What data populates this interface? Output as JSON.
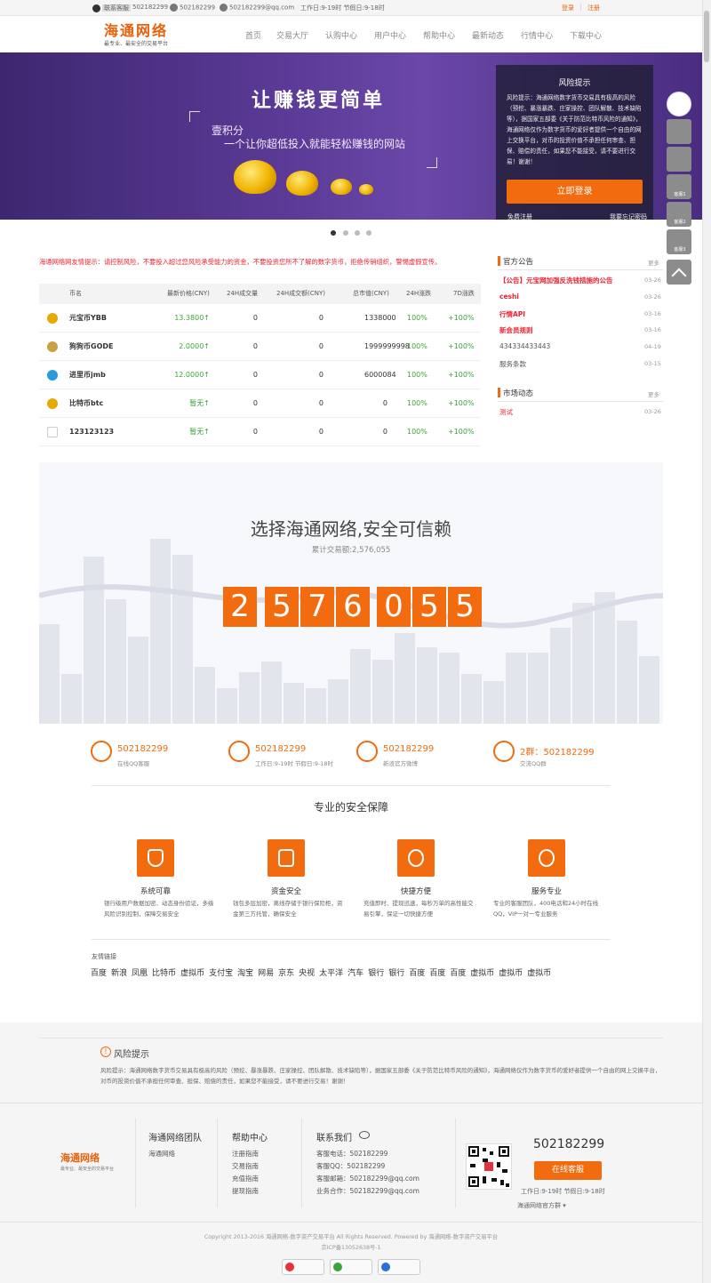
{
  "topbar": {
    "service": "联系客服",
    "qq": "502182299",
    "phone": "502182299",
    "email": "502182299@qq.com",
    "hours": "工作日:9-19时 节假日:9-18时",
    "login": "登录",
    "sep": "|",
    "register": "注册"
  },
  "logo": {
    "name": "海通网络",
    "slogan": "最专业、最安全的交易平台"
  },
  "nav": [
    "首页",
    "交易大厅",
    "认购中心",
    "用户中心",
    "帮助中心",
    "最新动态",
    "行情中心",
    "下载中心"
  ],
  "banner": {
    "slogan": "让赚钱更简单",
    "sub1": "壹积分",
    "sub2": "一个让你超低投入就能轻松赚钱的网站"
  },
  "risk": {
    "title": "风险提示",
    "body": "风险提示：海通网络数字货币交易具有极高的风险（预挖、暴涨暴跌、庄家操控、团队解散、技术缺陷等），据国家五部委《关于防范比特币风险的通知》，海通网络仅作为数字货币的爱好者提供一个自由的网上交换平台，对币的投资价值不承担任何审查、担保、赔偿的责任，如果您不能接受，请不要进行交易！谢谢！",
    "login": "立即登录",
    "free_reg": "免费注册",
    "forgot": "我要忘记密码"
  },
  "notice": "海通网络网友情提示：请控制风险，不要投入超过您风险承受能力的资金，不要投资您所不了解的数字货币，拒绝传销组织，警惕虚假宣传。",
  "table": {
    "headers": [
      "币名",
      "最新价格(CNY)",
      "24H成交量",
      "24H成交额(CNY)",
      "总市值(CNY)",
      "24H涨跌",
      "7D涨跌"
    ],
    "rows": [
      {
        "name": "元宝币YBB",
        "price": "13.3800↑",
        "vol": "0",
        "amt": "0",
        "cap": "1338000",
        "d24": "100%",
        "d7": "+100%",
        "color": "#e5a900"
      },
      {
        "name": "狗狗币GODE",
        "price": "2.0000↑",
        "vol": "0",
        "amt": "0",
        "cap": "1999999998",
        "d24": "100%",
        "d7": "+100%",
        "color": "#c8a242"
      },
      {
        "name": "进里币jmb",
        "price": "12.0000↑",
        "vol": "0",
        "amt": "0",
        "cap": "6000084",
        "d24": "100%",
        "d7": "+100%",
        "color": "#2a9ad9"
      },
      {
        "name": "比特币btc",
        "price": "暂无↑",
        "vol": "0",
        "amt": "0",
        "cap": "0",
        "d24": "100%",
        "d7": "+100%",
        "color": "#e5a900"
      },
      {
        "name": "123123123",
        "price": "暂无↑",
        "vol": "0",
        "amt": "0",
        "cap": "0",
        "d24": "100%",
        "d7": "+100%",
        "color": "#cccccc"
      }
    ]
  },
  "announce": {
    "title": "官方公告",
    "more": "更多",
    "items": [
      {
        "t": "【公告】元宝网加强反洗钱措施的公告",
        "d": "03-26",
        "red": true
      },
      {
        "t": "ceshi",
        "d": "03-26",
        "red": true
      },
      {
        "t": "行情API",
        "d": "03-16",
        "red": true
      },
      {
        "t": "新会员规则",
        "d": "03-16",
        "red": true
      },
      {
        "t": "434334433443",
        "d": "04-19",
        "red": false
      },
      {
        "t": "服务条款",
        "d": "03-15",
        "red": false
      }
    ]
  },
  "market": {
    "title": "市场动态",
    "more": "更多",
    "items": [
      {
        "t": "测试",
        "d": "03-26"
      }
    ]
  },
  "stats": {
    "title": "选择海通网络,安全可信赖",
    "sub": "累计交易额:2,576,055",
    "digits": [
      "2",
      "5",
      "7",
      "6",
      "0",
      "5",
      "5"
    ]
  },
  "contacts": [
    {
      "num": "502182299",
      "sub": "在线QQ客服",
      "icon": "qq-icon"
    },
    {
      "num": "502182299",
      "sub": "工作日:9-19时 节假日:9-18时",
      "icon": "phone-icon"
    },
    {
      "num": "502182299",
      "sub": "新浪官方微博",
      "icon": "weibo-icon"
    },
    {
      "num": "2群：502182299",
      "sub": "交流QQ群",
      "icon": "group-icon"
    }
  ],
  "security": {
    "title": "专业的安全保障",
    "items": [
      {
        "t": "系统可靠",
        "d": "银行级用户数据加密、动态身份验证，多级风险识别控制，保障交易安全",
        "icon": "shield-icon"
      },
      {
        "t": "资金安全",
        "d": "钱包多层加密，离线存储于银行保险柜，资金第三方托管，确保安全",
        "icon": "lock-icon"
      },
      {
        "t": "快捷方便",
        "d": "充值即时、提现迅速，每秒万单的高性能交易引擎，保证一切快捷方便",
        "icon": "lightning-icon"
      },
      {
        "t": "服务专业",
        "d": "专业的客服团队，400电话和24小时在线QQ，VIP一对一专业服务",
        "icon": "heart-icon"
      }
    ]
  },
  "links": {
    "title": "友情链接",
    "items": [
      "百度",
      "新浪",
      "凤凰",
      "比特币",
      "虚拟币",
      "支付宝",
      "淘宝",
      "网易",
      "京东",
      "央视",
      "太平洋",
      "汽车",
      "银行",
      "银行",
      "百度",
      "百度",
      "百度",
      "虚拟币",
      "虚拟币",
      "虚拟币"
    ]
  },
  "footer_risk": {
    "title": "风险提示",
    "body": "风险提示：海通网络数字货币交易具有极高的风险（预挖、暴涨暴跌、庄家操控、团队解散、技术缺陷等），据国家五部委《关于防范比特币风险的通知》，海通网络仅作为数字货币的爱好者提供一个自由的网上交换平台，对币的投资价值不承担任何审查、担保、赔偿的责任，如果您不能接受，请不要进行交易！谢谢！"
  },
  "footer": {
    "team_title": "海通网络团队",
    "team_item": "海通网络",
    "help_title": "帮助中心",
    "help_items": [
      "注册指南",
      "交易指南",
      "充值指南",
      "提现指南"
    ],
    "contact_title": "联系我们",
    "contact_items": [
      "客服电话：502182299",
      "客服QQ：502182299",
      "客服邮箱：502182299@qq.com",
      "业务合作：502182299@qq.com"
    ],
    "phone": "502182299",
    "qq_btn": "在线客服",
    "hours": "工作日:9-19时 节假日:9-18时",
    "qq_group": "海通网络官方群",
    "copyright": "Copyright 2013-2016 海通网络-数字资产交易平台 All Rights Reserved. Powered by 海通网络-数字资产交易平台",
    "icp": "京ICP备13052638号-1"
  },
  "float": {
    "kf1": "客服1",
    "kf2": "客服2",
    "kf3": "客服3"
  },
  "colors": {
    "accent": "#f26b0f",
    "red": "#e23",
    "green": "#3aa63a"
  }
}
